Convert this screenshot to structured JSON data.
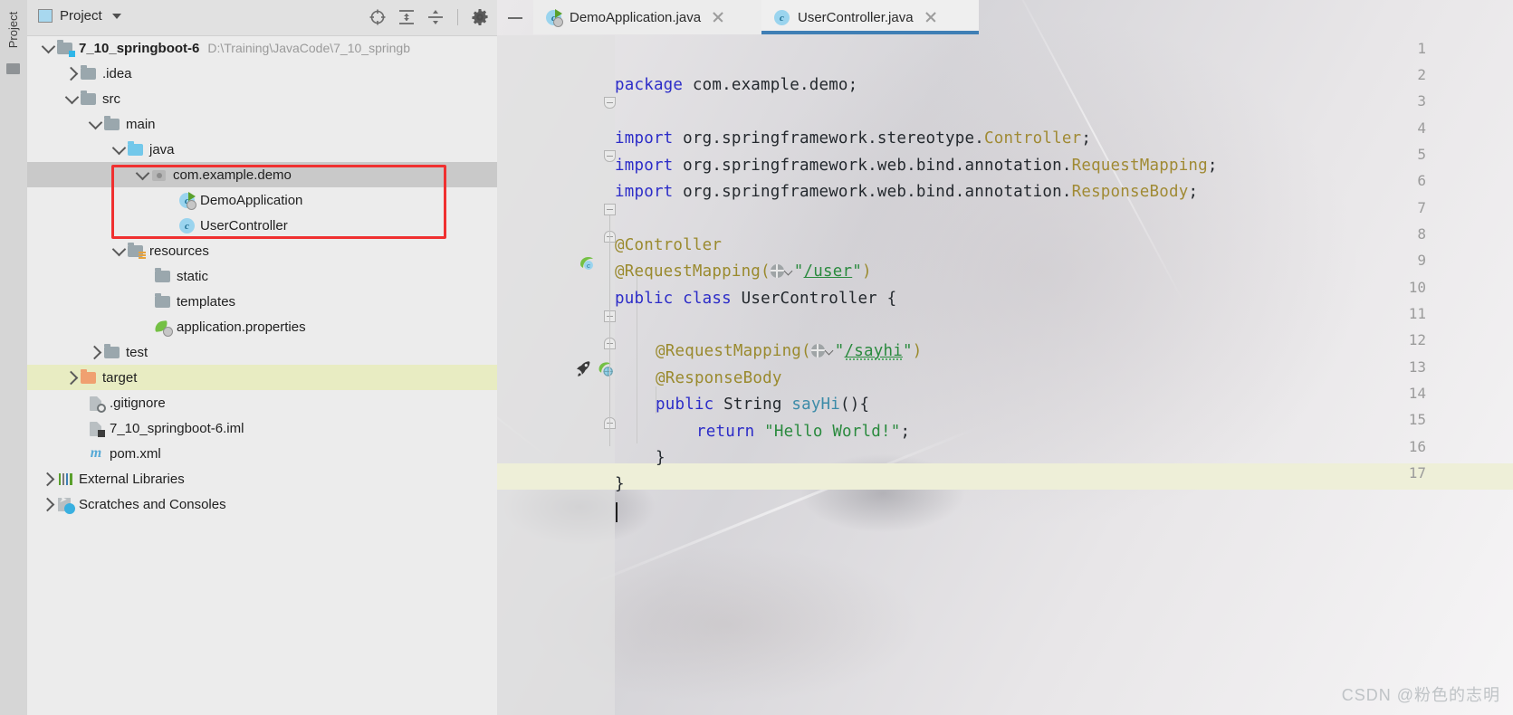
{
  "toolstrip": {
    "project_tab": "Project"
  },
  "panel": {
    "title": "Project",
    "title_icon": "project-view-icon",
    "tools": [
      {
        "name": "locate-icon",
        "label": "Select Opened File"
      },
      {
        "name": "expand-all-icon",
        "label": "Expand All"
      },
      {
        "name": "collapse-all-icon",
        "label": "Collapse All"
      },
      {
        "name": "gear-icon",
        "label": "Settings"
      }
    ]
  },
  "tree": [
    {
      "label": "7_10_springboot-6",
      "path": "D:\\Training\\JavaCode\\7_10_springb",
      "icon": "module-folder-icon",
      "depth": 0,
      "twist": "down",
      "bold": true,
      "state": "none"
    },
    {
      "label": ".idea",
      "path": "",
      "icon": "folder-icon",
      "depth": 1,
      "twist": "right",
      "bold": false,
      "state": "none"
    },
    {
      "label": "src",
      "path": "",
      "icon": "folder-icon",
      "depth": 1,
      "twist": "down",
      "bold": false,
      "state": "none"
    },
    {
      "label": "main",
      "path": "",
      "icon": "folder-icon",
      "depth": 2,
      "twist": "down",
      "bold": false,
      "state": "none"
    },
    {
      "label": "java",
      "path": "",
      "icon": "source-folder-icon",
      "depth": 3,
      "twist": "down",
      "bold": false,
      "state": "none"
    },
    {
      "label": "com.example.demo",
      "path": "",
      "icon": "package-icon",
      "depth": 4,
      "twist": "down",
      "bold": false,
      "state": "selected"
    },
    {
      "label": "DemoApplication",
      "path": "",
      "icon": "java-run-class-icon",
      "depth": 5,
      "twist": "none",
      "bold": false,
      "state": "none"
    },
    {
      "label": "UserController",
      "path": "",
      "icon": "java-class-icon",
      "depth": 5,
      "twist": "none",
      "bold": false,
      "state": "none"
    },
    {
      "label": "resources",
      "path": "",
      "icon": "resources-folder-icon",
      "depth": 3,
      "twist": "down",
      "bold": false,
      "state": "none"
    },
    {
      "label": "static",
      "path": "",
      "icon": "folder-icon",
      "depth": 4,
      "twist": "none",
      "bold": false,
      "state": "none"
    },
    {
      "label": "templates",
      "path": "",
      "icon": "folder-icon",
      "depth": 4,
      "twist": "none",
      "bold": false,
      "state": "none"
    },
    {
      "label": "application.properties",
      "path": "",
      "icon": "spring-properties-icon",
      "depth": 4,
      "twist": "none",
      "bold": false,
      "state": "none"
    },
    {
      "label": "test",
      "path": "",
      "icon": "folder-icon",
      "depth": 2,
      "twist": "right",
      "bold": false,
      "state": "none"
    },
    {
      "label": "target",
      "path": "",
      "icon": "excluded-folder-icon",
      "depth": 1,
      "twist": "right",
      "bold": false,
      "state": "highlight"
    },
    {
      "label": ".gitignore",
      "path": "",
      "icon": "gitignore-file-icon",
      "depth": 2,
      "twist": "none",
      "bold": false,
      "state": "none"
    },
    {
      "label": "7_10_springboot-6.iml",
      "path": "",
      "icon": "iml-file-icon",
      "depth": 2,
      "twist": "none",
      "bold": false,
      "state": "none"
    },
    {
      "label": "pom.xml",
      "path": "",
      "icon": "maven-file-icon",
      "depth": 2,
      "twist": "none",
      "bold": false,
      "state": "none"
    },
    {
      "label": "External Libraries",
      "path": "",
      "icon": "libraries-icon",
      "depth": 0,
      "twist": "right",
      "bold": false,
      "state": "none"
    },
    {
      "label": "Scratches and Consoles",
      "path": "",
      "icon": "scratches-icon",
      "depth": 0,
      "twist": "right",
      "bold": false,
      "state": "none"
    }
  ],
  "editor": {
    "minimize_label": "—",
    "tabs": [
      {
        "label": "DemoApplication.java",
        "icon": "java-run-class-icon",
        "active": false
      },
      {
        "label": "UserController.java",
        "icon": "java-class-icon",
        "active": true
      }
    ],
    "line_numbers": [
      "1",
      "2",
      "3",
      "4",
      "5",
      "6",
      "7",
      "8",
      "9",
      "10",
      "11",
      "12",
      "13",
      "14",
      "15",
      "16",
      "17"
    ],
    "gutter_icons": [
      {
        "line": "9",
        "name": "spring-bean-icon"
      },
      {
        "line": "13",
        "name": "run-method-rocket-icon"
      },
      {
        "line": "13",
        "name": "spring-request-mapping-icon"
      }
    ],
    "code": {
      "l1_kw": "package",
      "l1_rest": " com.example.demo;",
      "l3_kw": "import",
      "l3_pkg": " org.springframework.stereotype.",
      "l3_cls": "Controller",
      "l3_end": ";",
      "l4_kw": "import",
      "l4_pkg": " org.springframework.web.bind.annotation.",
      "l4_cls": "RequestMapping",
      "l4_end": ";",
      "l5_kw": "import",
      "l5_pkg": " org.springframework.web.bind.annotation.",
      "l5_cls": "ResponseBody",
      "l5_end": ";",
      "l7_ann": "@Controller",
      "l8_ann": "@RequestMapping(",
      "l8_q1": "\"",
      "l8_url": "/user",
      "l8_q2": "\"",
      "l8_close": ")",
      "l9_kw1": "public",
      "l9_kw2": "class",
      "l9_name": "UserController",
      "l9_brace": "{",
      "l11_ann": "@RequestMapping(",
      "l11_q1": "\"",
      "l11_url": "/sayhi",
      "l11_q2": "\"",
      "l11_close": ")",
      "l12_ann": "@ResponseBody",
      "l13_kw1": "public",
      "l13_type": "String",
      "l13_mth": "sayHi",
      "l13_tail": "(){",
      "l14_kw": "return",
      "l14_str": "\"Hello World!\"",
      "l14_end": ";",
      "l15_brace": "}",
      "l16_brace": "}"
    }
  },
  "watermark": "CSDN @粉色的志明",
  "colors": {
    "accent": "#3f7fb5",
    "keyword": "#2c2cc8",
    "annotation": "#9a8a2e",
    "string": "#2a8a3e",
    "method": "#3c8ba8",
    "selection": "#c9c9c9",
    "caret_row": "#eeefd8",
    "red_box": "#f03030"
  }
}
